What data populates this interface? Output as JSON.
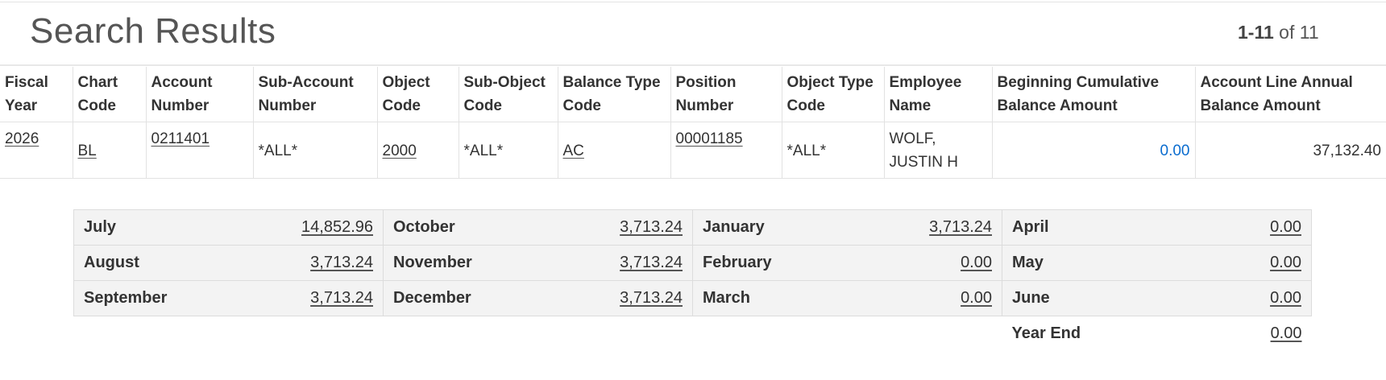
{
  "header": {
    "title": "Search Results",
    "paging_range": "1-11",
    "paging_of": "of 11"
  },
  "results": {
    "columns": [
      "Fiscal Year",
      "Chart Code",
      "Account Number",
      "Sub-Account Number",
      "Object Code",
      "Sub-Object Code",
      "Balance Type Code",
      "Position Number",
      "Object Type Code",
      "Employee Name",
      "Beginning Cumulative Balance Amount",
      "Account Line Annual Balance Amount"
    ],
    "row": {
      "fiscal_year": "2026",
      "chart_code": "BL",
      "account_number": "0211401",
      "sub_account_number": "*ALL*",
      "object_code": "2000",
      "sub_object_code": "*ALL*",
      "balance_type_code": "AC",
      "position_number": "00001185",
      "object_type_code": "*ALL*",
      "employee_name": "WOLF, JUSTIN H",
      "beginning_cumulative_balance": "0.00",
      "annual_balance": "37,132.40"
    }
  },
  "months": {
    "rows": [
      [
        {
          "name": "July",
          "value": "14,852.96"
        },
        {
          "name": "October",
          "value": "3,713.24"
        },
        {
          "name": "January",
          "value": "3,713.24"
        },
        {
          "name": "April",
          "value": "0.00"
        }
      ],
      [
        {
          "name": "August",
          "value": "3,713.24"
        },
        {
          "name": "November",
          "value": "3,713.24"
        },
        {
          "name": "February",
          "value": "0.00"
        },
        {
          "name": "May",
          "value": "0.00"
        }
      ],
      [
        {
          "name": "September",
          "value": "3,713.24"
        },
        {
          "name": "December",
          "value": "3,713.24"
        },
        {
          "name": "March",
          "value": "0.00"
        },
        {
          "name": "June",
          "value": "0.00"
        }
      ]
    ],
    "year_end": {
      "name": "Year End",
      "value": "0.00"
    }
  },
  "colors": {
    "link_blue": "#0a6ccf",
    "month_bg": "#f3f3f3",
    "border": "#e2e2e2"
  }
}
